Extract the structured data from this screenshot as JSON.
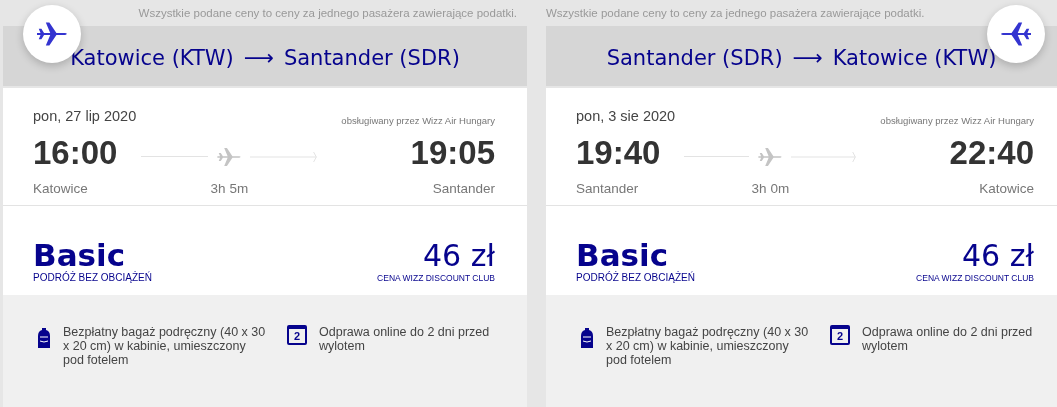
{
  "flights": [
    {
      "mirrored": false,
      "note": "Wszystkie podane ceny to ceny za jednego pasażera zawierające podatki.",
      "route": {
        "from": "Katowice (KTW)",
        "arrow": "⟶",
        "to": "Santander (SDR)"
      },
      "date": "pon, 27 lip 2020",
      "operator": "obsługiwany przez Wizz Air Hungary",
      "departure": {
        "time": "16:00",
        "city": "Katowice"
      },
      "duration": "3h 5m",
      "arrival": {
        "time": "19:05",
        "city": "Santander"
      },
      "fare": {
        "name": "Basic",
        "subtitle": "PODRÓŻ BEZ OBCIĄŻEŃ",
        "price": "46 zł",
        "price_note": "CENA WIZZ DISCOUNT CLUB"
      },
      "features": [
        {
          "kind": "bag",
          "text": "Bezpłatny bagaż podręczny (40 x 30 x 20 cm) w kabinie, umieszczony pod fotelem"
        },
        {
          "kind": "calendar",
          "icon_text": "2",
          "text": "Odprawa online do 2 dni przed wylotem"
        }
      ]
    },
    {
      "mirrored": true,
      "note": "Wszystkie podane ceny to ceny za jednego pasażera zawierające podatki.",
      "route": {
        "from": "Santander (SDR)",
        "arrow": "⟶",
        "to": "Katowice (KTW)"
      },
      "date": "pon, 3 sie 2020",
      "operator": "obsługiwany przez Wizz Air Hungary",
      "departure": {
        "time": "19:40",
        "city": "Santander"
      },
      "duration": "3h 0m",
      "arrival": {
        "time": "22:40",
        "city": "Katowice"
      },
      "fare": {
        "name": "Basic",
        "subtitle": "PODRÓŻ BEZ OBCIĄŻEŃ",
        "price": "46 zł",
        "price_note": "CENA WIZZ DISCOUNT CLUB"
      },
      "features": [
        {
          "kind": "bag",
          "text": "Bezpłatny bagaż podręczny (40 x 30 x 20 cm) w kabinie, umieszczony pod fotelem"
        },
        {
          "kind": "calendar",
          "icon_text": "2",
          "text": "Odprawa online do 2 dni przed wylotem"
        }
      ]
    }
  ]
}
